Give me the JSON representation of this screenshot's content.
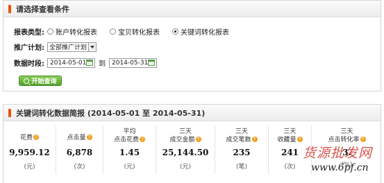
{
  "query_panel": {
    "title": "请选择查看条件",
    "report_type_label": "报表类型:",
    "report_types": [
      {
        "label": "账户转化报表",
        "selected": false
      },
      {
        "label": "宝贝转化报表",
        "selected": false
      },
      {
        "label": "关键词转化报表",
        "selected": true
      }
    ],
    "plan_label": "推广计划:",
    "plan_value": "全部推广计划",
    "period_label": "数据时段:",
    "date_from": "2014-05-01",
    "date_sep": "到",
    "date_to": "2014-05-31",
    "search_button": "开始查询"
  },
  "summary_panel": {
    "title": "关键词转化数据简报 (2014-05-01 至 2014-05-31)",
    "metrics": [
      {
        "line1": "",
        "line2": "花费",
        "value": "9,959.12",
        "unit": "(元)"
      },
      {
        "line1": "",
        "line2": "点击量",
        "value": "6,878",
        "unit": "(次)"
      },
      {
        "line1": "平均",
        "line2": "点击花费",
        "value": "1.45",
        "unit": "(元)"
      },
      {
        "line1": "三天",
        "line2": "成交金额",
        "value": "25,144.50",
        "unit": "(元)"
      },
      {
        "line1": "三天",
        "line2": "成交笔数",
        "value": "235",
        "unit": "(笔)"
      },
      {
        "line1": "三天",
        "line2": "收藏量",
        "value": "241",
        "unit": "(次)"
      },
      {
        "line1": "三天",
        "line2": "点击转化率",
        "value": "3.",
        "unit": "(%)"
      }
    ]
  },
  "watermark": {
    "line1": "货源批发网",
    "line2": "www.6pf.cn"
  },
  "colors": {
    "accent": "#e8540c",
    "button": "#55a02c",
    "help": "#f0a020"
  }
}
